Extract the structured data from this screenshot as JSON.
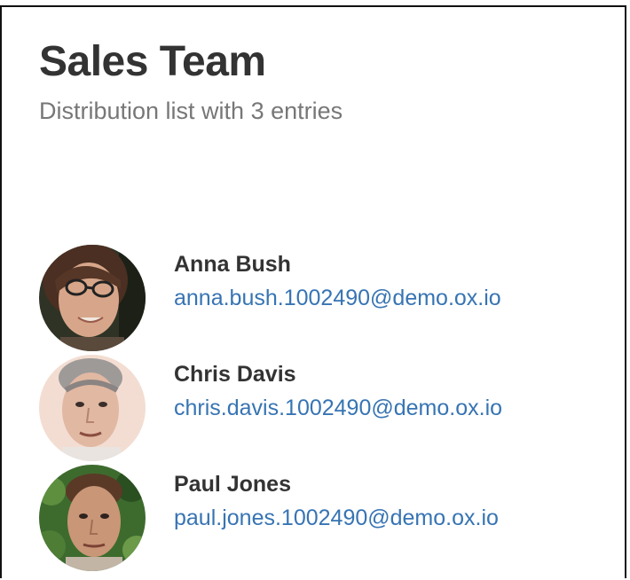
{
  "header": {
    "title": "Sales Team",
    "subtitle": "Distribution list with 3 entries"
  },
  "colors": {
    "link": "#3774b3",
    "title": "#333333",
    "subtitle": "#777777"
  },
  "members": [
    {
      "name": "Anna Bush",
      "email": "anna.bush.1002490@demo.ox.io",
      "avatar": "avatar-photo-anna-bush"
    },
    {
      "name": "Chris Davis",
      "email": "chris.davis.1002490@demo.ox.io",
      "avatar": "avatar-photo-chris-davis"
    },
    {
      "name": "Paul Jones",
      "email": "paul.jones.1002490@demo.ox.io",
      "avatar": "avatar-photo-paul-jones"
    }
  ]
}
